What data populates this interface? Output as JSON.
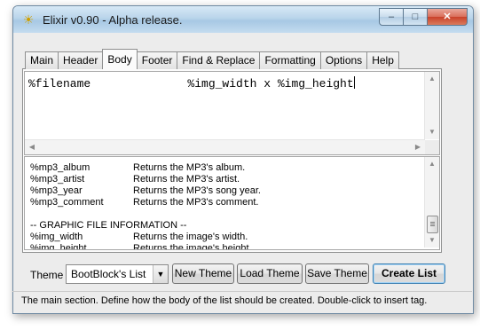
{
  "window": {
    "title": "Elixir v0.90 - Alpha release.",
    "app_icon": "lightbulb-icon",
    "min_glyph": "–",
    "max_glyph": "□",
    "close_glyph": "✕"
  },
  "tabs": [
    {
      "label": "Main",
      "active": false
    },
    {
      "label": "Header",
      "active": false
    },
    {
      "label": "Body",
      "active": true
    },
    {
      "label": "Footer",
      "active": false
    },
    {
      "label": "Find & Replace",
      "active": false
    },
    {
      "label": "Formatting",
      "active": false
    },
    {
      "label": "Options",
      "active": false
    },
    {
      "label": "Help",
      "active": false
    }
  ],
  "editor": {
    "content": "%filename              %img_width x %img_height"
  },
  "reference": {
    "rows": [
      {
        "tag": "%mp3_album",
        "desc": "Returns the MP3's album."
      },
      {
        "tag": "%mp3_artist",
        "desc": "Returns the MP3's artist."
      },
      {
        "tag": "%mp3_year",
        "desc": "Returns the MP3's song year."
      },
      {
        "tag": "%mp3_comment",
        "desc": "Returns the MP3's comment."
      },
      {
        "tag": "",
        "desc": ""
      },
      {
        "tag": "-- GRAPHIC FILE INFORMATION --",
        "desc": ""
      },
      {
        "tag": "%img_width",
        "desc": "Returns the image's width."
      },
      {
        "tag": "%img_height",
        "desc": "Returns the image's height."
      }
    ]
  },
  "bottom": {
    "theme_label": "Theme",
    "theme_value": "BootBlock's List",
    "new_theme": "New Theme",
    "load_theme": "Load Theme",
    "save_theme": "Save Theme",
    "create_list": "Create List"
  },
  "status": {
    "text": "The main section. Define how the body of the list should be created. Double-click to insert tag."
  }
}
